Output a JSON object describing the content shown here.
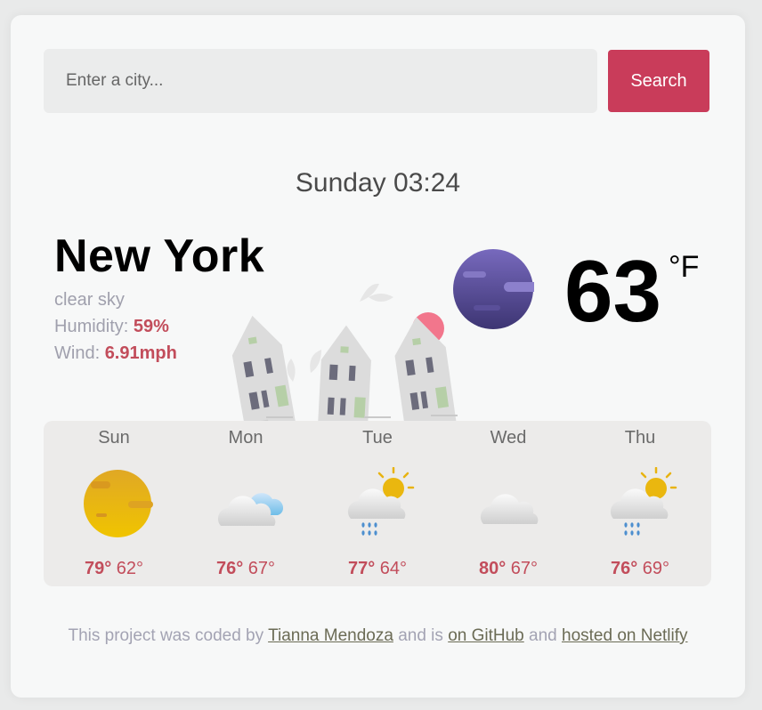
{
  "search": {
    "placeholder": "Enter a city...",
    "button_label": "Search"
  },
  "current": {
    "datetime": "Sunday 03:24",
    "city": "New York",
    "description": "clear sky",
    "humidity_label": "Humidity:",
    "humidity_value": "59%",
    "wind_label": "Wind:",
    "wind_value": "6.91mph",
    "temperature": "63",
    "unit": "°F",
    "icon": "moon-icon"
  },
  "forecast": [
    {
      "day": "Sun",
      "max": "79°",
      "min": "62°",
      "icon": "sun-icon"
    },
    {
      "day": "Mon",
      "max": "76°",
      "min": "67°",
      "icon": "cloud-icon"
    },
    {
      "day": "Tue",
      "max": "77°",
      "min": "64°",
      "icon": "sun-rain-icon"
    },
    {
      "day": "Wed",
      "max": "80°",
      "min": "67°",
      "icon": "cloud-icon"
    },
    {
      "day": "Thu",
      "max": "76°",
      "min": "69°",
      "icon": "sun-rain-icon"
    }
  ],
  "footer": {
    "text_1": "This project was coded by",
    "author": "Tianna Mendoza",
    "text_2": "and is",
    "github": "on GitHub",
    "text_3": "and",
    "netlify": "hosted on Netlify"
  },
  "colors": {
    "accent": "#c93c5a",
    "value": "#c24d5b",
    "muted": "#a0a0ad"
  }
}
